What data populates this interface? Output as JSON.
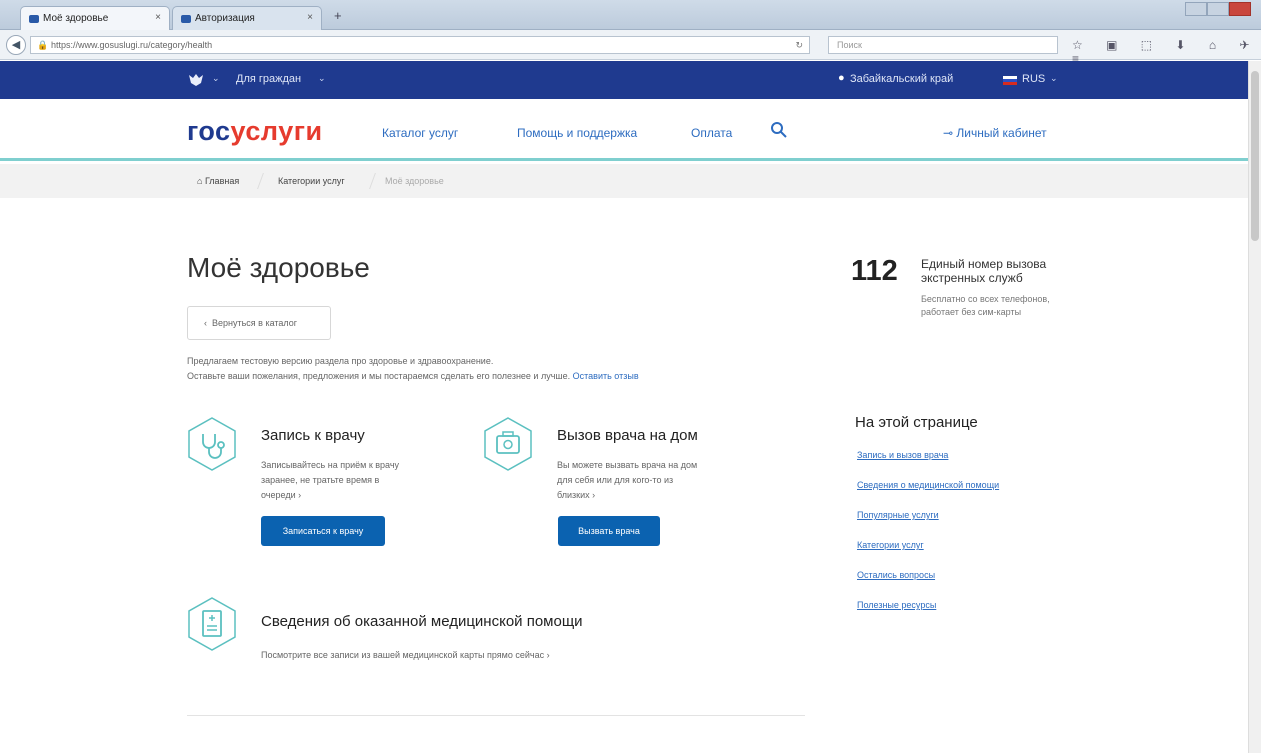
{
  "browser": {
    "tabs": [
      {
        "title": "Моё здоровье"
      },
      {
        "title": "Авторизация"
      }
    ],
    "url": "https://www.gosuslugi.ru/category/health",
    "search_placeholder": "Поиск"
  },
  "topnav": {
    "citizens": "Для граждан",
    "region": "Забайкальский край",
    "lang": "RUS"
  },
  "header": {
    "logo_part1": "гос",
    "logo_part2": "услуги",
    "nav": [
      "Каталог услуг",
      "Помощь и поддержка",
      "Оплата"
    ],
    "cabinet": "Личный кабинет"
  },
  "breadcrumb": [
    "Главная",
    "Категории услуг",
    "Моё здоровье"
  ],
  "page": {
    "title": "Моё здоровье",
    "back_label": "Вернуться в каталог",
    "intro_line1": "Предлагаем тестовую версию раздела про здоровье и здравоохранение.",
    "intro_line2": "Оставьте ваши пожелания, предложения и мы постараемся сделать его полезнее и лучше.",
    "feedback_link": "Оставить отзыв"
  },
  "services": [
    {
      "title": "Запись к врачу",
      "desc1": "Записывайтесь на приём к врачу",
      "desc2": "заранее, не тратьте время в",
      "desc3": "очереди",
      "button": "Записаться к врачу"
    },
    {
      "title": "Вызов врача на дом",
      "desc1": "Вы можете вызвать врача на дом",
      "desc2": "для себя или для кого-то из",
      "desc3": "близких",
      "button": "Вызвать врача"
    },
    {
      "title": "Сведения об оказанной медицинской помощи",
      "desc1": "Посмотрите все записи из вашей медицинской карты прямо сейчас"
    }
  ],
  "emergency": {
    "number": "112",
    "title": "Единый номер вызова экстренных служб",
    "desc": "Бесплатно со всех телефонов, работает без сим-карты"
  },
  "onpage": {
    "title": "На этой странице",
    "links": [
      "Запись и вызов врача",
      "Сведения о медицинской помощи",
      "Популярные услуги",
      "Категории услуг",
      "Остались вопросы",
      "Полезные ресурсы"
    ]
  },
  "colors": {
    "brand_blue": "#1f3a8f",
    "brand_red": "#e63b2e",
    "link": "#2d6cc0",
    "button": "#0b62b0",
    "teal": "#5bc0c0"
  }
}
